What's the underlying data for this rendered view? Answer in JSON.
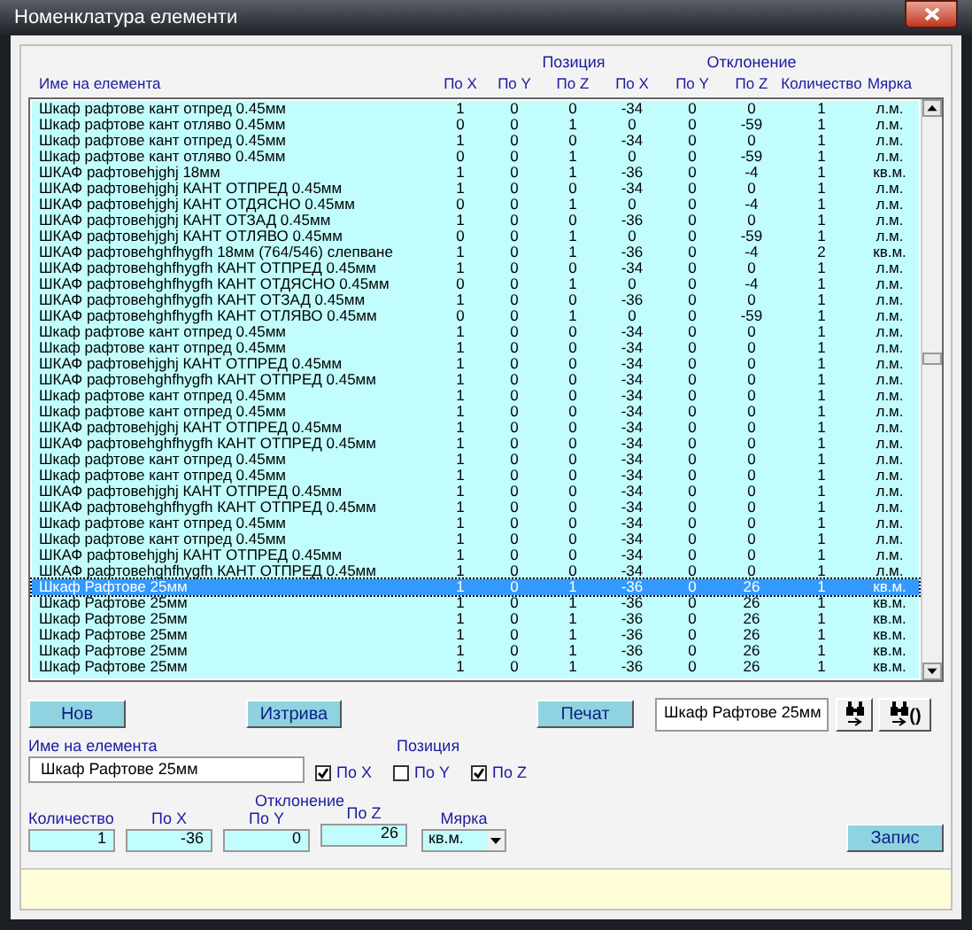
{
  "window": {
    "title": "Номенклатура елементи"
  },
  "table": {
    "group_headers": [
      {
        "label": "Позиция"
      },
      {
        "label": "Отклонение"
      }
    ],
    "columns": [
      "Име на елемента",
      "По X",
      "По Y",
      "По Z",
      "По X",
      "По Y",
      "По Z",
      "Количество",
      "Мярка"
    ],
    "rows": [
      {
        "cells": [
          "Шкаф рафтове кант отпред 0.45мм",
          "1",
          "0",
          "0",
          "-34",
          "0",
          "0",
          "1",
          "л.м."
        ],
        "selected": false
      },
      {
        "cells": [
          "Шкаф рафтове кант отляво 0.45мм",
          "0",
          "0",
          "1",
          "0",
          "0",
          "-59",
          "1",
          "л.м."
        ],
        "selected": false
      },
      {
        "cells": [
          "Шкаф рафтове кант отпред 0.45мм",
          "1",
          "0",
          "0",
          "-34",
          "0",
          "0",
          "1",
          "л.м."
        ],
        "selected": false
      },
      {
        "cells": [
          "Шкаф рафтове кант отляво 0.45мм",
          "0",
          "0",
          "1",
          "0",
          "0",
          "-59",
          "1",
          "л.м."
        ],
        "selected": false
      },
      {
        "cells": [
          "ШКАФ рафтовеhjghj 18мм",
          "1",
          "0",
          "1",
          "-36",
          "0",
          "-4",
          "1",
          "кв.м."
        ],
        "selected": false
      },
      {
        "cells": [
          "ШКАФ рафтовеhjghj КАНТ ОТПРЕД 0.45мм",
          "1",
          "0",
          "0",
          "-34",
          "0",
          "0",
          "1",
          "л.м."
        ],
        "selected": false
      },
      {
        "cells": [
          "ШКАФ рафтовеhjghj КАНТ ОТДЯСНО 0.45мм",
          "0",
          "0",
          "1",
          "0",
          "0",
          "-4",
          "1",
          "л.м."
        ],
        "selected": false
      },
      {
        "cells": [
          "ШКАФ рафтовеhjghj КАНТ ОТЗАД 0.45мм",
          "1",
          "0",
          "0",
          "-36",
          "0",
          "0",
          "1",
          "л.м."
        ],
        "selected": false
      },
      {
        "cells": [
          "ШКАФ рафтовеhjghj КАНТ ОТЛЯВО 0.45мм",
          "0",
          "0",
          "1",
          "0",
          "0",
          "-59",
          "1",
          "л.м."
        ],
        "selected": false
      },
      {
        "cells": [
          "ШКАФ рафтовеhghfhygfh 18мм (764/546) слепване",
          "1",
          "0",
          "1",
          "-36",
          "0",
          "-4",
          "2",
          "кв.м."
        ],
        "selected": false
      },
      {
        "cells": [
          "ШКАФ рафтовеhghfhygfh КАНТ ОТПРЕД 0.45мм",
          "1",
          "0",
          "0",
          "-34",
          "0",
          "0",
          "1",
          "л.м."
        ],
        "selected": false
      },
      {
        "cells": [
          "ШКАФ рафтовеhghfhygfh КАНТ ОТДЯСНО 0.45мм",
          "0",
          "0",
          "1",
          "0",
          "0",
          "-4",
          "1",
          "л.м."
        ],
        "selected": false
      },
      {
        "cells": [
          "ШКАФ рафтовеhghfhygfh КАНТ ОТЗАД 0.45мм",
          "1",
          "0",
          "0",
          "-36",
          "0",
          "0",
          "1",
          "л.м."
        ],
        "selected": false
      },
      {
        "cells": [
          "ШКАФ рафтовеhghfhygfh КАНТ ОТЛЯВО 0.45мм",
          "0",
          "0",
          "1",
          "0",
          "0",
          "-59",
          "1",
          "л.м."
        ],
        "selected": false
      },
      {
        "cells": [
          "Шкаф рафтове кант отпред 0.45мм",
          "1",
          "0",
          "0",
          "-34",
          "0",
          "0",
          "1",
          "л.м."
        ],
        "selected": false
      },
      {
        "cells": [
          "Шкаф рафтове кант отпред 0.45мм",
          "1",
          "0",
          "0",
          "-34",
          "0",
          "0",
          "1",
          "л.м."
        ],
        "selected": false
      },
      {
        "cells": [
          "ШКАФ рафтовеhjghj КАНТ ОТПРЕД 0.45мм",
          "1",
          "0",
          "0",
          "-34",
          "0",
          "0",
          "1",
          "л.м."
        ],
        "selected": false
      },
      {
        "cells": [
          "ШКАФ рафтовеhghfhygfh КАНТ ОТПРЕД 0.45мм",
          "1",
          "0",
          "0",
          "-34",
          "0",
          "0",
          "1",
          "л.м."
        ],
        "selected": false
      },
      {
        "cells": [
          "Шкаф рафтове кант отпред 0.45мм",
          "1",
          "0",
          "0",
          "-34",
          "0",
          "0",
          "1",
          "л.м."
        ],
        "selected": false
      },
      {
        "cells": [
          "Шкаф рафтове кант отпред 0.45мм",
          "1",
          "0",
          "0",
          "-34",
          "0",
          "0",
          "1",
          "л.м."
        ],
        "selected": false
      },
      {
        "cells": [
          "ШКАФ рафтовеhjghj КАНТ ОТПРЕД 0.45мм",
          "1",
          "0",
          "0",
          "-34",
          "0",
          "0",
          "1",
          "л.м."
        ],
        "selected": false
      },
      {
        "cells": [
          "ШКАФ рафтовеhghfhygfh КАНТ ОТПРЕД 0.45мм",
          "1",
          "0",
          "0",
          "-34",
          "0",
          "0",
          "1",
          "л.м."
        ],
        "selected": false
      },
      {
        "cells": [
          "Шкаф рафтове кант отпред 0.45мм",
          "1",
          "0",
          "0",
          "-34",
          "0",
          "0",
          "1",
          "л.м."
        ],
        "selected": false
      },
      {
        "cells": [
          "Шкаф рафтове кант отпред 0.45мм",
          "1",
          "0",
          "0",
          "-34",
          "0",
          "0",
          "1",
          "л.м."
        ],
        "selected": false
      },
      {
        "cells": [
          "ШКАФ рафтовеhjghj КАНТ ОТПРЕД 0.45мм",
          "1",
          "0",
          "0",
          "-34",
          "0",
          "0",
          "1",
          "л.м."
        ],
        "selected": false
      },
      {
        "cells": [
          "ШКАФ рафтовеhghfhygfh КАНТ ОТПРЕД 0.45мм",
          "1",
          "0",
          "0",
          "-34",
          "0",
          "0",
          "1",
          "л.м."
        ],
        "selected": false
      },
      {
        "cells": [
          "Шкаф рафтове кант отпред 0.45мм",
          "1",
          "0",
          "0",
          "-34",
          "0",
          "0",
          "1",
          "л.м."
        ],
        "selected": false
      },
      {
        "cells": [
          "Шкаф рафтове кант отпред 0.45мм",
          "1",
          "0",
          "0",
          "-34",
          "0",
          "0",
          "1",
          "л.м."
        ],
        "selected": false
      },
      {
        "cells": [
          "ШКАФ рафтовеhjghj КАНТ ОТПРЕД 0.45мм",
          "1",
          "0",
          "0",
          "-34",
          "0",
          "0",
          "1",
          "л.м."
        ],
        "selected": false
      },
      {
        "cells": [
          "ШКАФ рафтовеhghfhygfh КАНТ ОТПРЕД 0.45мм",
          "1",
          "0",
          "0",
          "-34",
          "0",
          "0",
          "1",
          "л.м."
        ],
        "selected": false
      },
      {
        "cells": [
          "Шкаф Рафтове 25мм",
          "1",
          "0",
          "1",
          "-36",
          "0",
          "26",
          "1",
          "кв.м."
        ],
        "selected": true
      },
      {
        "cells": [
          "Шкаф Рафтове 25мм",
          "1",
          "0",
          "1",
          "-36",
          "0",
          "26",
          "1",
          "кв.м."
        ],
        "selected": false
      },
      {
        "cells": [
          "Шкаф Рафтове 25мм",
          "1",
          "0",
          "1",
          "-36",
          "0",
          "26",
          "1",
          "кв.м."
        ],
        "selected": false
      },
      {
        "cells": [
          "Шкаф Рафтове 25мм",
          "1",
          "0",
          "1",
          "-36",
          "0",
          "26",
          "1",
          "кв.м."
        ],
        "selected": false
      },
      {
        "cells": [
          "Шкаф Рафтове 25мм",
          "1",
          "0",
          "1",
          "-36",
          "0",
          "26",
          "1",
          "кв.м."
        ],
        "selected": false
      },
      {
        "cells": [
          "Шкаф Рафтове 25мм",
          "1",
          "0",
          "1",
          "-36",
          "0",
          "26",
          "1",
          "кв.м."
        ],
        "selected": false
      }
    ]
  },
  "actions": {
    "new": "Нов",
    "delete": "Изтрива",
    "print": "Печат",
    "search_value": "Шкаф Рафтове 25мм",
    "find_all_label": "()"
  },
  "form": {
    "name_label": "Име на елемента",
    "name_value": "Шкаф Рафтове 25мм",
    "position_label": "Позиция",
    "position_axes": [
      {
        "label": "По X",
        "checked": true
      },
      {
        "label": "По Y",
        "checked": false
      },
      {
        "label": "По Z",
        "checked": true
      }
    ],
    "deviation_label": "Отклонение",
    "fields": [
      {
        "label": "Количество",
        "value": "1"
      },
      {
        "label": "По X",
        "value": "-36"
      },
      {
        "label": "По Y",
        "value": "0"
      },
      {
        "label": "По Z",
        "value": "26"
      }
    ],
    "unit_label": "Мярка",
    "unit_value": "кв.м.",
    "save": "Запис"
  }
}
